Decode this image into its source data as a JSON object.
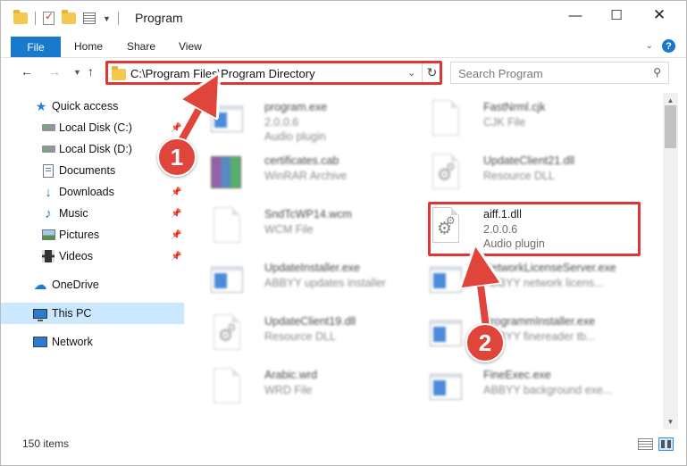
{
  "window": {
    "title": "Program",
    "min_glyph": "—",
    "max_glyph": "☐",
    "close_glyph": "✕"
  },
  "ribbon": {
    "file": "File",
    "home": "Home",
    "share": "Share",
    "view": "View",
    "help_glyph": "?"
  },
  "nav": {
    "address": "C:\\Program Files\\Program Directory",
    "search_placeholder": "Search Program"
  },
  "sidebar": {
    "items": [
      {
        "label": "Quick access",
        "icon": "star-icon"
      },
      {
        "label": "Local Disk (C:)",
        "icon": "drive-icon",
        "pinned": true
      },
      {
        "label": "Local Disk (D:)",
        "icon": "drive-icon",
        "pinned": true
      },
      {
        "label": "Documents",
        "icon": "documents-icon",
        "pinned": true
      },
      {
        "label": "Downloads",
        "icon": "downloads-icon",
        "pinned": true
      },
      {
        "label": "Music",
        "icon": "music-icon",
        "pinned": true
      },
      {
        "label": "Pictures",
        "icon": "pictures-icon",
        "pinned": true
      },
      {
        "label": "Videos",
        "icon": "videos-icon",
        "pinned": true
      },
      {
        "label": "OneDrive",
        "icon": "cloud-icon"
      },
      {
        "label": "This PC",
        "icon": "computer-icon",
        "selected": true
      },
      {
        "label": "Network",
        "icon": "network-icon"
      }
    ]
  },
  "files": {
    "left": [
      {
        "name": "program.exe",
        "line2": "2.0.0.6",
        "line3": "Audio plugin",
        "icon": "exe-icon"
      },
      {
        "name": "certificates.cab",
        "line2": "WinRAR Archive",
        "line3": "",
        "icon": "archive-icon"
      },
      {
        "name": "SndTcWP14.wcm",
        "line2": "WCM File",
        "line3": "",
        "icon": "file-icon"
      },
      {
        "name": "UpdateInstaller.exe",
        "line2": "ABBYY updates installer",
        "line3": "",
        "icon": "exe-icon"
      },
      {
        "name": "UpdateClient19.dll",
        "line2": "Resource DLL",
        "line3": "",
        "icon": "dll-icon"
      },
      {
        "name": "Arabic.wrd",
        "line2": "WRD File",
        "line3": "",
        "icon": "file-icon"
      }
    ],
    "right": [
      {
        "name": "FastNrml.cjk",
        "line2": "CJK File",
        "line3": "",
        "icon": "file-icon"
      },
      {
        "name": "UpdateClient21.dll",
        "line2": "Resource DLL",
        "line3": "",
        "icon": "dll-icon"
      },
      {
        "name": "aiff.1.dll",
        "line2": "2.0.0.6",
        "line3": "Audio plugin",
        "icon": "dll-icon",
        "highlighted": true
      },
      {
        "name": "NetworkLicenseServer.exe",
        "line2": "ABBYY network licens...",
        "line3": "",
        "icon": "exe-icon"
      },
      {
        "name": "ProgrammInstaller.exe",
        "line2": "ABBYY finereader tb...",
        "line3": "",
        "icon": "exe-icon"
      },
      {
        "name": "FineExec.exe",
        "line2": "ABBYY background exe...",
        "line3": "",
        "icon": "exe-icon"
      }
    ]
  },
  "status": {
    "items_count": "150 items"
  },
  "annotations": {
    "step1": "1",
    "step2": "2",
    "color": "#e0453c"
  }
}
